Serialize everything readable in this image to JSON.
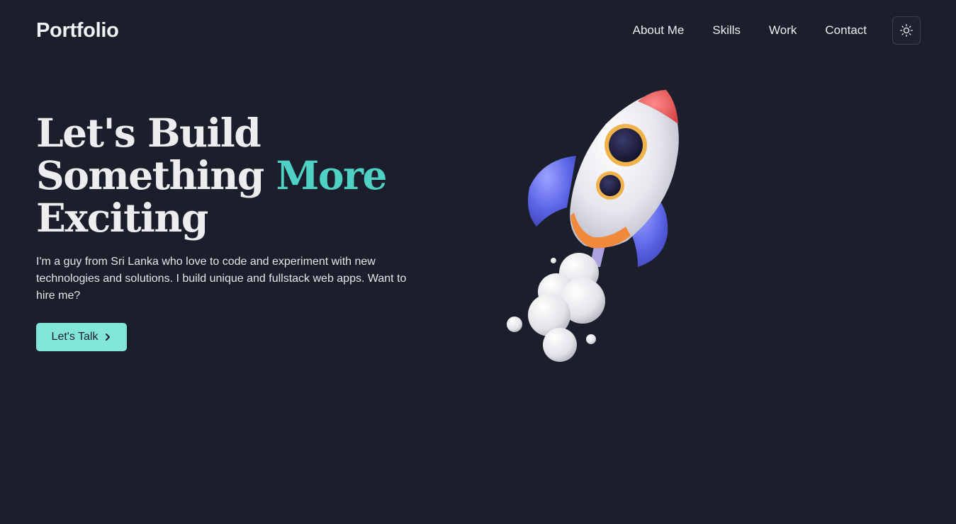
{
  "header": {
    "logo": "Portfolio",
    "nav": [
      "About Me",
      "Skills",
      "Work",
      "Contact"
    ],
    "theme_toggle_icon": "sun-icon"
  },
  "hero": {
    "title_line1": "Let's Build",
    "title_line2_a": "Something",
    "title_line2_accent": "More",
    "title_line3": "Exciting",
    "description": "I'm a guy from Sri Lanka who love to code and experiment with new technologies and solutions. I build unique and fullstack web apps. Want to hire me?",
    "cta_label": "Let's Talk",
    "cta_icon": "chevron-right-icon",
    "illustration": "rocket-illustration"
  },
  "colors": {
    "background": "#1b1f2b",
    "accent": "#4fd1c5",
    "button": "#81e6d9",
    "text": "#ececef"
  }
}
